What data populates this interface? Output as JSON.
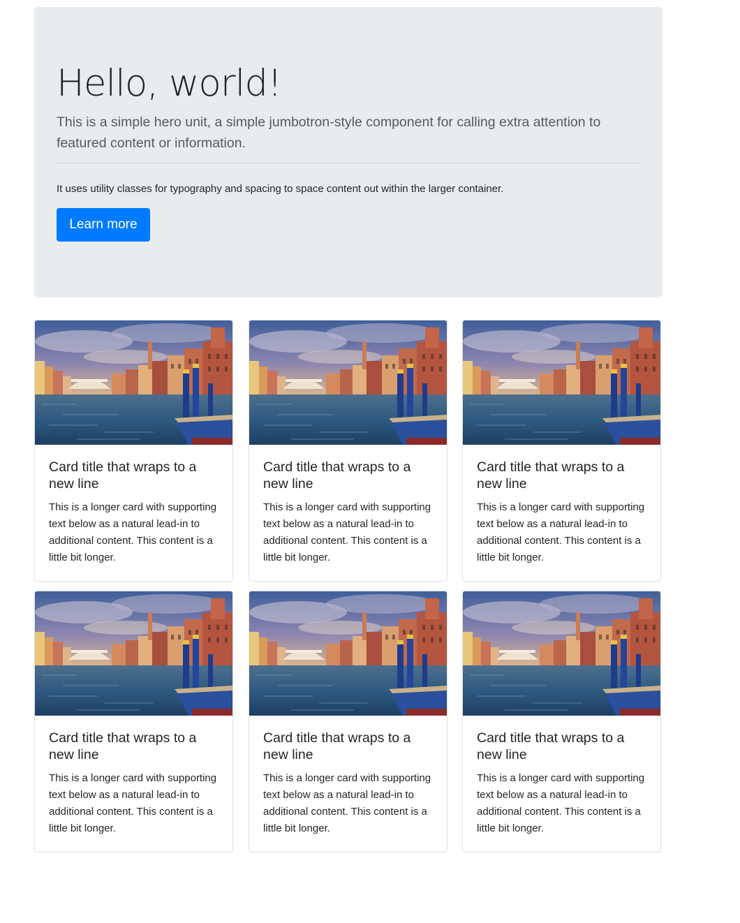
{
  "jumbotron": {
    "title": "Hello, world!",
    "lead": "This is a simple hero unit, a simple jumbotron-style component for calling extra attention to featured content or information.",
    "text": "It uses utility classes for typography and spacing to space content out within the larger container.",
    "button_label": "Learn more",
    "background_color": "#e9ecef",
    "button_color": "#007bff"
  },
  "cards": [
    {
      "image": "venice-grand-canal-image",
      "title": "Card title that wraps to a new line",
      "text": "This is a longer card with supporting text below as a natural lead-in to additional content. This content is a little bit longer."
    },
    {
      "image": "venice-grand-canal-image",
      "title": "Card title that wraps to a new line",
      "text": "This is a longer card with supporting text below as a natural lead-in to additional content. This content is a little bit longer."
    },
    {
      "image": "venice-grand-canal-image",
      "title": "Card title that wraps to a new line",
      "text": "This is a longer card with supporting text below as a natural lead-in to additional content. This content is a little bit longer."
    },
    {
      "image": "venice-grand-canal-image",
      "title": "Card title that wraps to a new line",
      "text": "This is a longer card with supporting text below as a natural lead-in to additional content. This content is a little bit longer."
    },
    {
      "image": "venice-grand-canal-image",
      "title": "Card title that wraps to a new line",
      "text": "This is a longer card with supporting text below as a natural lead-in to additional content. This content is a little bit longer."
    },
    {
      "image": "venice-grand-canal-image",
      "title": "Card title that wraps to a new line",
      "text": "This is a longer card with supporting text below as a natural lead-in to additional content. This content is a little bit longer."
    }
  ]
}
